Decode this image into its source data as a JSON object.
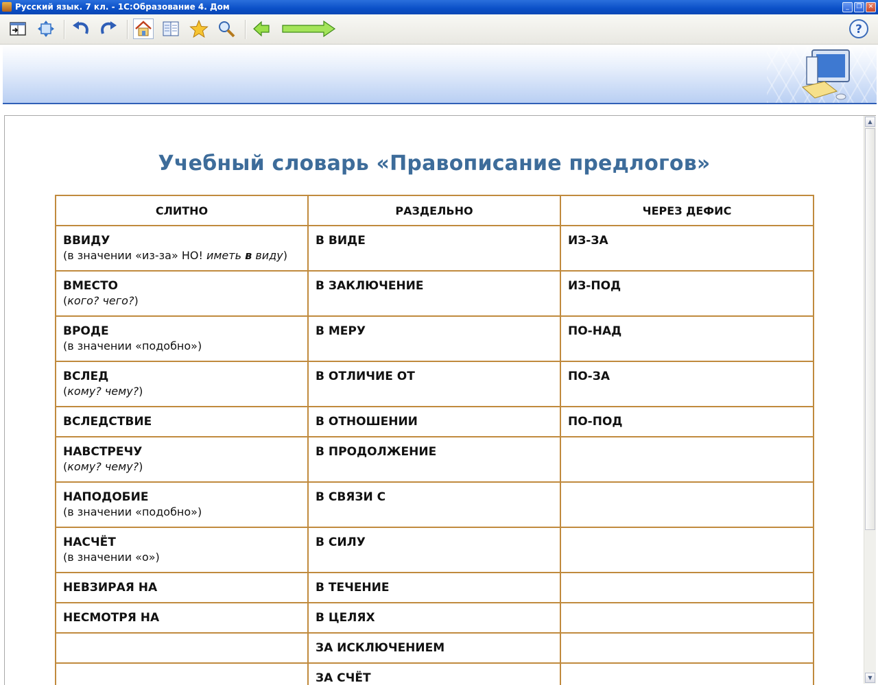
{
  "window": {
    "title": "Русский язык. 7 кл. - 1С:Образование 4. Дом",
    "buttons": {
      "minimize": "_",
      "restore": "❐",
      "close": "✕"
    }
  },
  "toolbar": {
    "items": [
      "exit-icon",
      "fit-window-icon",
      "undo-icon",
      "redo-icon",
      "home-icon",
      "book-icon",
      "favorites-star-icon",
      "search-magnifier-icon",
      "back-arrow-icon",
      "forward-arrow-icon",
      "help-icon"
    ],
    "help_label": "?",
    "accent": "#2f5fb7"
  },
  "page": {
    "title": "Учебный словарь «Правописание предлогов»"
  },
  "table": {
    "headers": [
      "СЛИТНО",
      "РАЗДЕЛЬНО",
      "ЧЕРЕЗ ДЕФИС"
    ],
    "border_color": "#c08a3d",
    "rows": [
      {
        "c1": {
          "word": "ВВИДУ",
          "note_pre": "(в значении «из-за» НО! ",
          "note_it1": "иметь ",
          "note_bold": "в",
          "note_it2": " виду",
          "note_post": ")"
        },
        "c2": "В ВИДЕ",
        "c3": "ИЗ-ЗА"
      },
      {
        "c1": {
          "word": "ВМЕСТО",
          "note_pre": "(",
          "note_it1": "кого? чего?",
          "note_post": ")"
        },
        "c2": "В ЗАКЛЮЧЕНИЕ",
        "c3": "ИЗ-ПОД"
      },
      {
        "c1": {
          "word": "ВРОДЕ",
          "note_pre": "(в значении «подобно»)"
        },
        "c2": "В МЕРУ",
        "c3": "ПО-НАД"
      },
      {
        "c1": {
          "word": "ВСЛЕД",
          "note_pre": "(",
          "note_it1": "кому? чему?",
          "note_post": ")"
        },
        "c2": "В ОТЛИЧИЕ ОТ",
        "c3": "ПО-ЗА"
      },
      {
        "c1": {
          "word": "ВСЛЕДСТВИЕ"
        },
        "c2": "В ОТНОШЕНИИ",
        "c3": "ПО-ПОД"
      },
      {
        "c1": {
          "word": "НАВСТРЕЧУ",
          "note_pre": "(",
          "note_it1": "кому? чему?",
          "note_post": ")"
        },
        "c2": "В ПРОДОЛЖЕНИЕ",
        "c3": ""
      },
      {
        "c1": {
          "word": "НАПОДОБИЕ",
          "note_pre": "(в значении «подобно»)"
        },
        "c2": "В СВЯЗИ С",
        "c3": ""
      },
      {
        "c1": {
          "word": "НАСЧЁТ",
          "note_pre": "(в значении «о»)"
        },
        "c2": "В СИЛУ",
        "c3": ""
      },
      {
        "c1": {
          "word": "НЕВЗИРАЯ НА"
        },
        "c2": "В ТЕЧЕНИЕ",
        "c3": ""
      },
      {
        "c1": {
          "word": "НЕСМОТРЯ НА"
        },
        "c2": "В ЦЕЛЯХ",
        "c3": ""
      },
      {
        "c1": {
          "word": ""
        },
        "c2": "ЗА ИСКЛЮЧЕНИЕМ",
        "c3": ""
      },
      {
        "c1": {
          "word": ""
        },
        "c2": "ЗА СЧЁТ",
        "c3": ""
      }
    ]
  }
}
